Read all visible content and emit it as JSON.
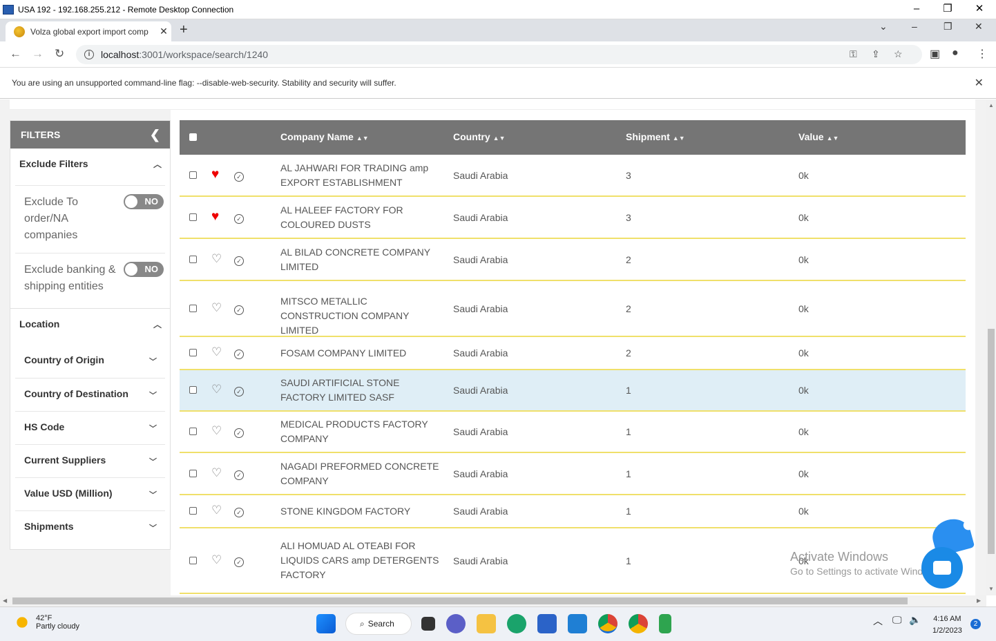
{
  "rd": {
    "title": "USA 192 - 192.168.255.212 - Remote Desktop Connection"
  },
  "browser": {
    "tab_title": "Volza global export import comp",
    "url_host": "localhost",
    "url_path": ":3001/workspace/search/1240",
    "warning": "You are using an unsupported command-line flag: --disable-web-security. Stability and security will suffer."
  },
  "filters": {
    "title": "FILTERS",
    "exclude_title": "Exclude Filters",
    "exclude_items": [
      {
        "label": "Exclude To order/NA companies",
        "state": "NO"
      },
      {
        "label": "Exclude banking & shipping entities",
        "state": "NO"
      }
    ],
    "location_title": "Location",
    "sections": [
      "Country of Origin",
      "Country of Destination",
      "HS Code",
      "Current Suppliers",
      "Value USD (Million)",
      "Shipments"
    ]
  },
  "table": {
    "headers": {
      "company": "Company Name",
      "country": "Country",
      "shipment": "Shipment",
      "value": "Value"
    },
    "rows": [
      {
        "name": "AL JAHWARI FOR TRADING amp EXPORT ESTABLISHMENT",
        "country": "Saudi Arabia",
        "shipment": "3",
        "value": "0k",
        "fav": true
      },
      {
        "name": "AL HALEEF FACTORY FOR COLOURED DUSTS",
        "country": "Saudi Arabia",
        "shipment": "3",
        "value": "0k",
        "fav": true
      },
      {
        "name": "AL BILAD CONCRETE COMPANY LIMITED",
        "country": "Saudi Arabia",
        "shipment": "2",
        "value": "0k",
        "fav": false
      },
      {
        "name": "MITSCO METALLIC CONSTRUCTION COMPANY LIMITED",
        "country": "Saudi Arabia",
        "shipment": "2",
        "value": "0k",
        "fav": false
      },
      {
        "name": "FOSAM COMPANY LIMITED",
        "country": "Saudi Arabia",
        "shipment": "2",
        "value": "0k",
        "fav": false
      },
      {
        "name": "SAUDI ARTIFICIAL STONE FACTORY LIMITED SASF",
        "country": "Saudi Arabia",
        "shipment": "1",
        "value": "0k",
        "fav": false
      },
      {
        "name": "MEDICAL PRODUCTS FACTORY COMPANY",
        "country": "Saudi Arabia",
        "shipment": "1",
        "value": "0k",
        "fav": false
      },
      {
        "name": "NAGADI PREFORMED CONCRETE COMPANY",
        "country": "Saudi Arabia",
        "shipment": "1",
        "value": "0k",
        "fav": false
      },
      {
        "name": "STONE KINGDOM FACTORY",
        "country": "Saudi Arabia",
        "shipment": "1",
        "value": "0k",
        "fav": false
      },
      {
        "name": "ALI HOMUAD AL OTEABI FOR LIQUIDS CARS amp DETERGENTS FACTORY",
        "country": "Saudi Arabia",
        "shipment": "1",
        "value": "0k",
        "fav": false
      }
    ]
  },
  "watermark": {
    "line1": "Activate Windows",
    "line2": "Go to Settings to activate Windows."
  },
  "taskbar": {
    "temp": "42°F",
    "weather": "Partly cloudy",
    "search": "Search",
    "time": "4:16 AM",
    "date": "1/2/2023",
    "notifications": "2"
  }
}
